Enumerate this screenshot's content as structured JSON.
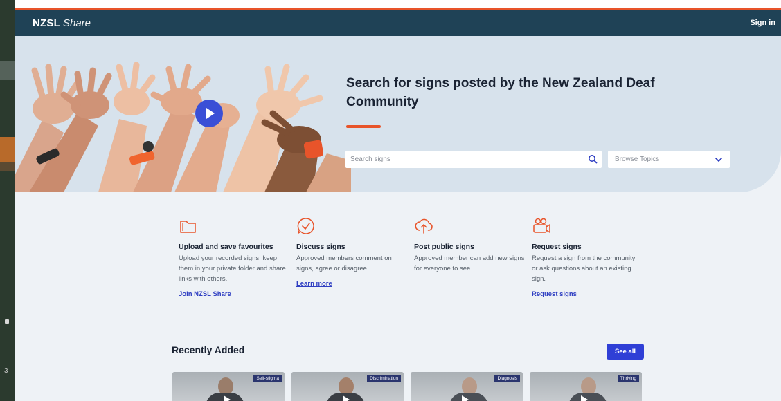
{
  "header": {
    "brand_strong": "NZSL",
    "brand_italic": "Share",
    "sign_in": "Sign in"
  },
  "hero": {
    "title": "Search for signs posted by the New Zealand Deaf Community",
    "search_placeholder": "Search signs",
    "browse_label": "Browse Topics"
  },
  "features": [
    {
      "title": "Upload and save favourites",
      "desc": "Upload your recorded signs, keep them in your private folder and share links with others.",
      "link": "Join NZSL Share",
      "icon": "folder-icon"
    },
    {
      "title": "Discuss signs",
      "desc": "Approved members comment on signs, agree or disagree",
      "link": "Learn more",
      "icon": "chat-check-icon"
    },
    {
      "title": "Post public signs",
      "desc": "Approved member can add new signs for everyone to see",
      "link": "",
      "icon": "cloud-upload-icon"
    },
    {
      "title": "Request signs",
      "desc": "Request a sign from the community or ask questions about an existing sign.",
      "link": "Request signs",
      "icon": "video-people-icon"
    }
  ],
  "recent": {
    "title": "Recently Added",
    "see_all": "See all",
    "cards": [
      {
        "tag": "Self-stigma"
      },
      {
        "tag": "Discrimination"
      },
      {
        "tag": "Diagnosis"
      },
      {
        "tag": "Thriving"
      }
    ]
  },
  "sidebar": {
    "number": "3"
  },
  "colors": {
    "header": "#1f4256",
    "accent": "#e8542a",
    "primary": "#2f3fd6",
    "hero_bg": "#d7e2ec",
    "page_bg": "#eef2f6"
  }
}
